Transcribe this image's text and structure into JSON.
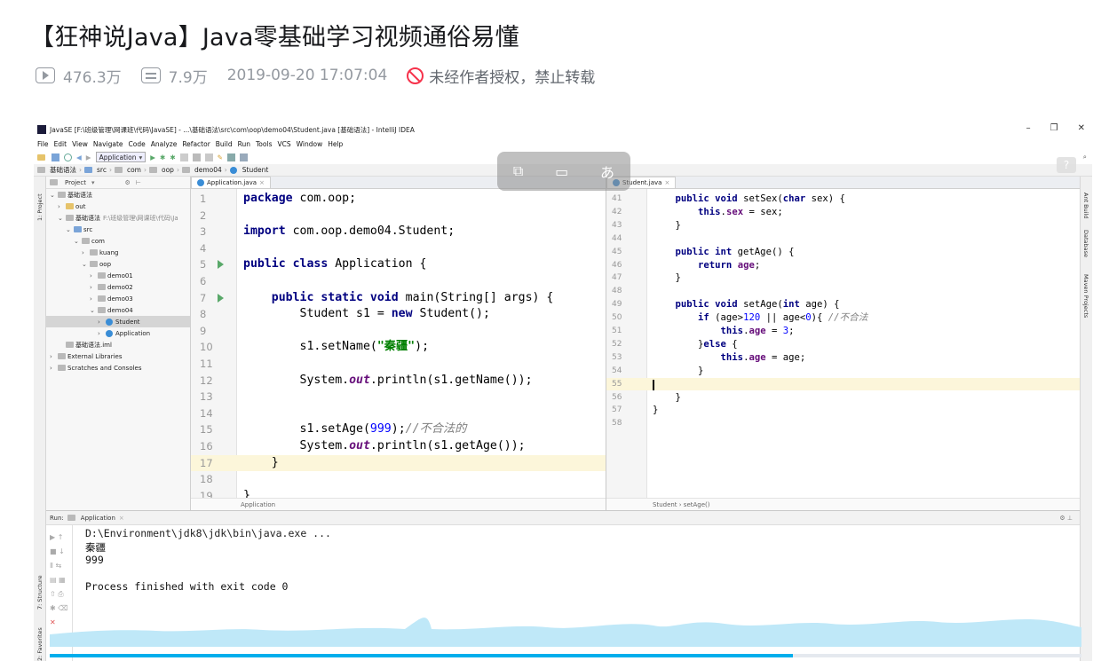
{
  "video": {
    "title": "【狂神说Java】Java零基础学习视频通俗易懂",
    "views": "476.3万",
    "danmaku": "7.9万",
    "pubdate": "2019-09-20 17:07:04",
    "copyright": "未经作者授权，禁止转载",
    "progress_fraction": 0.72
  },
  "ide": {
    "window_title": "JavaSE [F:\\班级管理\\网课班\\代码\\JavaSE] - ...\\基础语法\\src\\com\\oop\\demo04\\Student.java [基础语法] - IntelliJ IDEA",
    "win_controls": [
      "–",
      "❐",
      "✕"
    ],
    "menu": [
      "File",
      "Edit",
      "View",
      "Navigate",
      "Code",
      "Analyze",
      "Refactor",
      "Build",
      "Run",
      "Tools",
      "VCS",
      "Window",
      "Help"
    ],
    "run_config": "Application",
    "breadcrumb": [
      "基础语法",
      "src",
      "com",
      "oop",
      "demo04",
      "Student"
    ],
    "left_stripe": "1: Project",
    "left_stripe_bottom": [
      "7: Structure",
      "2: Favorites"
    ],
    "right_stripe": [
      "Ant Build",
      "Database",
      "Maven Projects"
    ],
    "project_header": "Project",
    "tree": [
      {
        "label": "基础语法",
        "depth": 0,
        "arrow": "v",
        "kind": "module"
      },
      {
        "label": "out",
        "depth": 1,
        "arrow": ">",
        "kind": "folder-yellow"
      },
      {
        "label": "基础语法",
        "sub": "F:\\班级管理\\网课班\\代码\\Ja",
        "depth": 1,
        "arrow": "v",
        "kind": "module"
      },
      {
        "label": "src",
        "depth": 2,
        "arrow": "v",
        "kind": "folder-blue"
      },
      {
        "label": "com",
        "depth": 3,
        "arrow": "v",
        "kind": "folder"
      },
      {
        "label": "kuang",
        "depth": 4,
        "arrow": ">",
        "kind": "folder"
      },
      {
        "label": "oop",
        "depth": 4,
        "arrow": "v",
        "kind": "folder"
      },
      {
        "label": "demo01",
        "depth": 5,
        "arrow": ">",
        "kind": "folder"
      },
      {
        "label": "demo02",
        "depth": 5,
        "arrow": ">",
        "kind": "folder"
      },
      {
        "label": "demo03",
        "depth": 5,
        "arrow": ">",
        "kind": "folder"
      },
      {
        "label": "demo04",
        "depth": 5,
        "arrow": "v",
        "kind": "folder"
      },
      {
        "label": "Student",
        "depth": 6,
        "arrow": ">",
        "kind": "class",
        "selected": true
      },
      {
        "label": "Application",
        "depth": 6,
        "arrow": ">",
        "kind": "class"
      },
      {
        "label": "基础语法.iml",
        "depth": 1,
        "arrow": "",
        "kind": "file"
      },
      {
        "label": "External Libraries",
        "depth": 0,
        "arrow": ">",
        "kind": "lib"
      },
      {
        "label": "Scratches and Consoles",
        "depth": 0,
        "arrow": ">",
        "kind": "lib"
      }
    ],
    "left_tab": "Application.java",
    "left_status": "Application",
    "left_lines": [
      "1",
      "2",
      "3",
      "4",
      "5",
      "6",
      "7",
      "8",
      "9",
      "10",
      "11",
      "12",
      "13",
      "14",
      "15",
      "16",
      "17",
      "18",
      "19"
    ],
    "right_tab": "Student.java",
    "right_status": "Student  ›  setAge()",
    "right_lines": [
      "41",
      "42",
      "43",
      "44",
      "45",
      "46",
      "47",
      "48",
      "49",
      "50",
      "51",
      "52",
      "53",
      "54",
      "55",
      "56",
      "57",
      "58"
    ],
    "run_label": "Run:",
    "run_tab": "Application",
    "output": [
      "D:\\Environment\\jdk8\\jdk\\bin\\java.exe ...",
      "秦疆",
      "999",
      "",
      "Process finished with exit code 0"
    ]
  },
  "colors": {
    "keyword": "#000080",
    "string": "#008000",
    "comment": "#808080",
    "field": "#660e7a",
    "progress": "#00aeec",
    "forbid": "#f6324b"
  }
}
